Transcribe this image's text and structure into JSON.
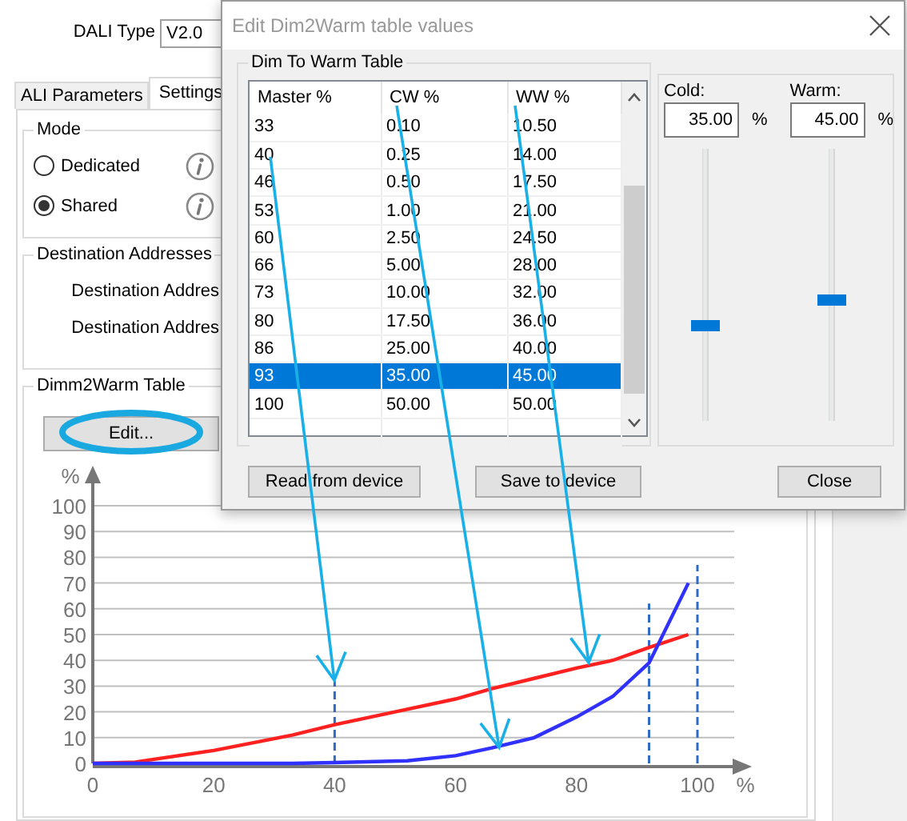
{
  "background_window": {
    "fields": [
      {
        "label": "DALI Type",
        "value": "V2.0"
      }
    ],
    "tabs": [
      {
        "label": "ALI Parameters",
        "selected": false
      },
      {
        "label": "Settings",
        "selected": true
      }
    ],
    "mode_group": {
      "title": "Mode",
      "options": [
        {
          "label": "Dedicated",
          "selected": false
        },
        {
          "label": "Shared",
          "selected": true
        }
      ]
    },
    "destination_group": {
      "title": "Destination Addresses",
      "labels": [
        "Destination Addres",
        "Destination Addres"
      ]
    },
    "dimm2warm_group": {
      "title": "Dimm2Warm Table",
      "button": "Edit...",
      "chart_data": {
        "type": "line",
        "xlabel": "%",
        "ylabel": "%",
        "x": [
          0,
          7,
          20,
          33,
          40,
          52,
          60,
          66,
          73,
          80,
          86,
          92,
          98.5
        ],
        "series": [
          {
            "color": "#ff2020",
            "values": [
              0,
              0.5,
              5,
              11,
              15,
              21,
              25,
              29,
              33,
              37,
              40,
              45,
              50
            ]
          },
          {
            "color": "#3030ff",
            "values": [
              0,
              0,
              0,
              0,
              0.3,
              1,
              3,
              6,
              10,
              18,
              26,
              39,
              70
            ]
          }
        ],
        "xlim": [
          0,
          100
        ],
        "ylim": [
          0,
          100
        ],
        "xticks": [
          0,
          20,
          40,
          60,
          80,
          100
        ],
        "yticks": [
          0,
          10,
          20,
          30,
          40,
          50,
          60,
          70,
          80,
          90,
          100
        ],
        "grid": true,
        "ref_lines": [
          {
            "axis": "x",
            "value": 40
          },
          {
            "axis": "x",
            "value": 92
          },
          {
            "axis": "x",
            "value": 100
          }
        ]
      }
    }
  },
  "dialog": {
    "title": "Edit Dim2Warm table values",
    "table_group": {
      "title": "Dim To Warm Table",
      "columns": [
        "Master %",
        "CW %",
        "WW %"
      ],
      "rows": [
        {
          "cells": [
            "33",
            "0.10",
            "10.50"
          ],
          "selected": false
        },
        {
          "cells": [
            "40",
            "0.25",
            "14.00"
          ],
          "selected": false
        },
        {
          "cells": [
            "46",
            "0.50",
            "17.50"
          ],
          "selected": false
        },
        {
          "cells": [
            "53",
            "1.00",
            "21.00"
          ],
          "selected": false
        },
        {
          "cells": [
            "60",
            "2.50",
            "24.50"
          ],
          "selected": false
        },
        {
          "cells": [
            "66",
            "5.00",
            "28.00"
          ],
          "selected": false
        },
        {
          "cells": [
            "73",
            "10.00",
            "32.00"
          ],
          "selected": false
        },
        {
          "cells": [
            "80",
            "17.50",
            "36.00"
          ],
          "selected": false
        },
        {
          "cells": [
            "86",
            "25.00",
            "40.00"
          ],
          "selected": false
        },
        {
          "cells": [
            "93",
            "35.00",
            "45.00"
          ],
          "selected": true
        },
        {
          "cells": [
            "100",
            "50.00",
            "50.00"
          ],
          "selected": false
        }
      ]
    },
    "sliders": [
      {
        "label": "Cold:",
        "value": "35.00",
        "unit": "%",
        "level": 0.35
      },
      {
        "label": "Warm:",
        "value": "45.00",
        "unit": "%",
        "level": 0.45
      }
    ],
    "buttons": [
      "Read from device",
      "Save to device",
      "Close"
    ]
  }
}
